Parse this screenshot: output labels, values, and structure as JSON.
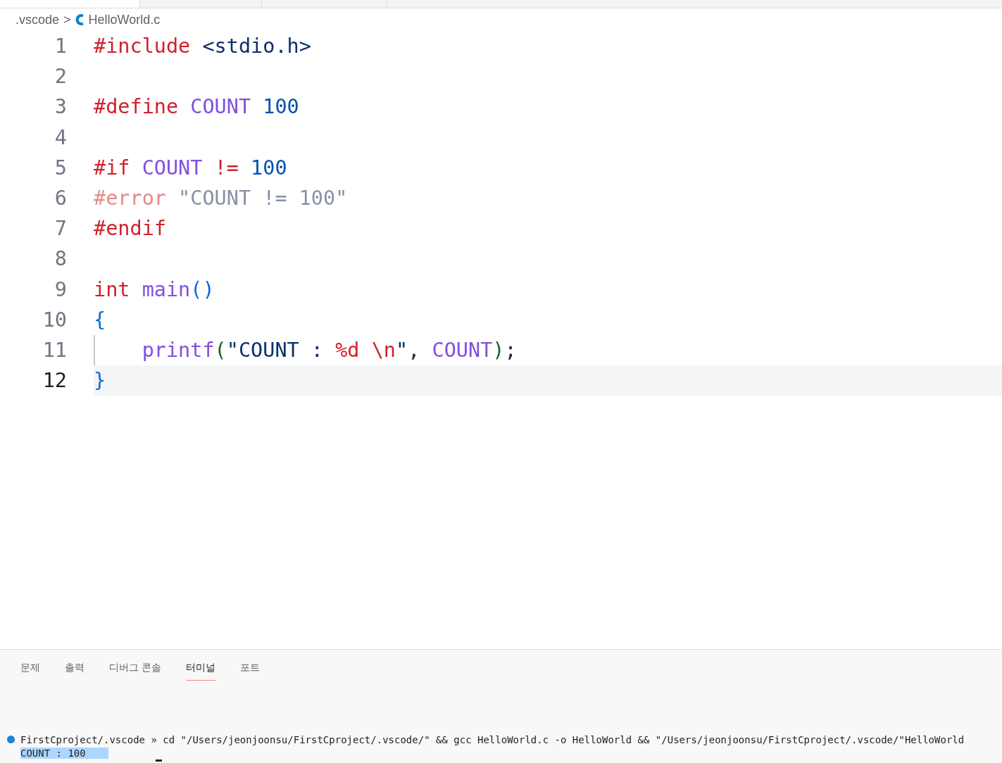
{
  "breadcrumb": {
    "folder": ".vscode",
    "separator": ">",
    "file": "HelloWorld.c"
  },
  "code_lines": [
    {
      "number": "1",
      "current": false,
      "tokens": [
        {
          "text": "#include",
          "kind": "directive"
        },
        {
          "text": " <stdio.h>",
          "kind": "string"
        }
      ]
    },
    {
      "number": "2",
      "current": false
    },
    {
      "number": "3",
      "current": false,
      "tokens": [
        {
          "text": "#define",
          "kind": "directive"
        },
        {
          "text": " COUNT",
          "kind": "name"
        },
        {
          "text": " 100",
          "kind": "number"
        }
      ]
    },
    {
      "number": "4",
      "current": false
    },
    {
      "number": "5",
      "current": false,
      "tokens": [
        {
          "text": "#if",
          "kind": "directive"
        },
        {
          "text": " COUNT",
          "kind": "name"
        },
        {
          "text": " !=",
          "kind": "directive"
        },
        {
          "text": " 100",
          "kind": "number"
        }
      ]
    },
    {
      "number": "6",
      "current": false,
      "tokens": [
        {
          "text": "#error",
          "kind": "faded-directive"
        },
        {
          "text": " \"COUNT != 100\"",
          "kind": "faded"
        }
      ]
    },
    {
      "number": "7",
      "current": false,
      "tokens": [
        {
          "text": "#endif",
          "kind": "directive"
        }
      ]
    },
    {
      "number": "8",
      "current": false
    },
    {
      "number": "9",
      "current": false,
      "tokens": [
        {
          "text": "int",
          "kind": "directive"
        },
        {
          "text": " main",
          "kind": "name"
        },
        {
          "text": "()",
          "kind": "bracket"
        }
      ]
    },
    {
      "number": "10",
      "current": false,
      "tokens": [
        {
          "text": "{",
          "kind": "bracket"
        }
      ]
    },
    {
      "number": "11",
      "current": false,
      "indent_guide": true,
      "tokens": [
        {
          "text": "    printf",
          "kind": "name"
        },
        {
          "text": "(",
          "kind": "paren"
        },
        {
          "text": "\"COUNT : ",
          "kind": "string"
        },
        {
          "text": "%d \\n",
          "kind": "directive"
        },
        {
          "text": "\"",
          "kind": "string"
        },
        {
          "text": ", ",
          "kind": "plain"
        },
        {
          "text": "COUNT",
          "kind": "name"
        },
        {
          "text": ")",
          "kind": "paren"
        },
        {
          "text": ";",
          "kind": "plain"
        }
      ]
    },
    {
      "number": "12",
      "current": true,
      "tokens": [
        {
          "text": "}",
          "kind": "bracket"
        }
      ]
    }
  ],
  "panel_tabs": [
    {
      "label": "문제",
      "selected": false
    },
    {
      "label": "출력",
      "selected": false
    },
    {
      "label": "디버그 콘솔",
      "selected": false
    },
    {
      "label": "터미널",
      "selected": true
    },
    {
      "label": "포트",
      "selected": false
    }
  ],
  "terminal_lines": [
    {
      "text": "FirstCproject/.vscode » cd \"/Users/jeonjoonsu/FirstCproject/.vscode/\" && gcc HelloWorld.c -o HelloWorld && \"/Users/jeonjoonsu/FirstCproject/.vscode/\"HelloWorld",
      "status_dot": true,
      "highlighted": false
    },
    {
      "text": "COUNT : 100",
      "status_dot": false,
      "highlighted": true
    }
  ]
}
